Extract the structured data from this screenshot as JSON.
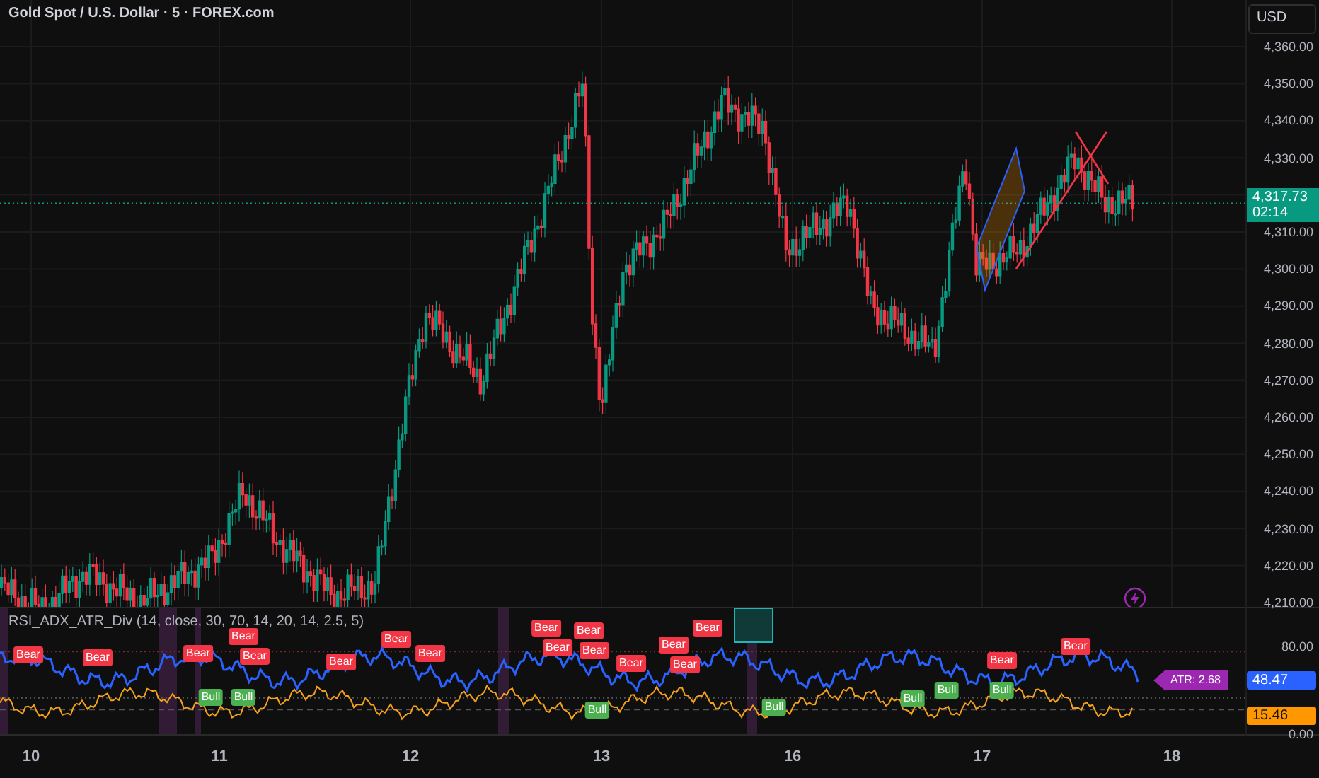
{
  "symbol_title": "Gold Spot / U.S. Dollar · 5 · FOREX.com",
  "currency": "USD",
  "price_axis": [
    "4,360.00",
    "4,350.00",
    "4,340.00",
    "4,330.00",
    "4,310.00",
    "4,300.00",
    "4,290.00",
    "4,280.00",
    "4,270.00",
    "4,260.00",
    "4,250.00",
    "4,240.00",
    "4,230.00",
    "4,220.00",
    "4,210.00"
  ],
  "last_price": {
    "price": "4,317.73",
    "countdown": "02:14"
  },
  "indicator": {
    "title": "RSI_ADX_ATR_Div (14, close, 30, 70, 14, 20, 14, 2.5, 5)",
    "axis": [
      "80.00",
      "0.00"
    ],
    "rsi_value": "48.47",
    "adx_value": "15.46",
    "atr_label": "ATR: 2.68",
    "signals": [
      {
        "kind": "bear",
        "label": "Bear"
      },
      {
        "kind": "bear",
        "label": "Bear"
      },
      {
        "kind": "bear",
        "label": "Bear"
      },
      {
        "kind": "bear",
        "label": "Bear"
      },
      {
        "kind": "bear",
        "label": "Bear"
      },
      {
        "kind": "bear",
        "label": "Bear"
      },
      {
        "kind": "bear",
        "label": "Bear"
      },
      {
        "kind": "bear",
        "label": "Bear"
      },
      {
        "kind": "bear",
        "label": "Bear"
      },
      {
        "kind": "bear",
        "label": "Bear"
      },
      {
        "kind": "bear",
        "label": "Bear"
      },
      {
        "kind": "bear",
        "label": "Bear"
      },
      {
        "kind": "bear",
        "label": "Bear"
      },
      {
        "kind": "bear",
        "label": "Bear"
      },
      {
        "kind": "bear",
        "label": "Bear"
      },
      {
        "kind": "bear",
        "label": "Bear"
      },
      {
        "kind": "bear",
        "label": "Bear"
      },
      {
        "kind": "bear",
        "label": "Bear"
      },
      {
        "kind": "bull",
        "label": "Bull"
      },
      {
        "kind": "bull",
        "label": "Bull"
      },
      {
        "kind": "bull",
        "label": "Bull"
      },
      {
        "kind": "bull",
        "label": "Bull"
      },
      {
        "kind": "bull",
        "label": "Bull"
      },
      {
        "kind": "bull",
        "label": "Bull"
      },
      {
        "kind": "bull",
        "label": "Bull"
      }
    ]
  },
  "time_axis": [
    "10",
    "11",
    "12",
    "13",
    "16",
    "17",
    "18"
  ]
}
